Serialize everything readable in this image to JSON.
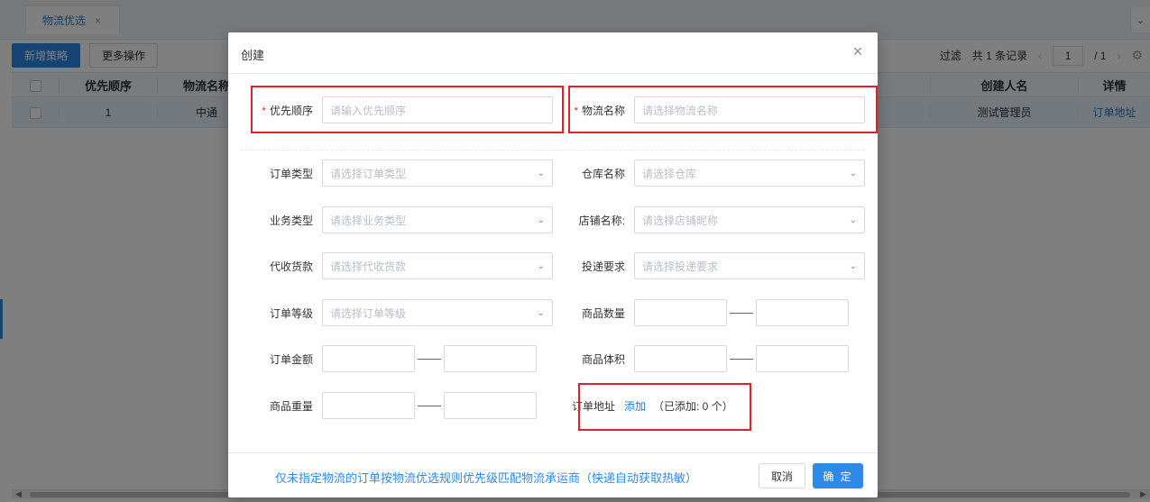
{
  "background": {
    "tab": {
      "label": "物流优选",
      "close": "×"
    },
    "toolbar": {
      "add_label": "新增策略",
      "more_label": "更多操作"
    },
    "pager": {
      "filter_text": "过滤",
      "total_text": "共 1 条记录",
      "prev": "‹",
      "page_input": "1",
      "page_text": "/ 1",
      "next": "›",
      "settings_icon": "gear-icon"
    },
    "table": {
      "headers": [
        "优先顺序",
        "物流名称",
        "创建人名",
        "详情"
      ],
      "rows": [
        {
          "priority": "1",
          "name": "中通",
          "creator": "测试管理员",
          "detail": "订单地址"
        }
      ]
    }
  },
  "dialog": {
    "title": "创建",
    "close": "×",
    "fields": {
      "priority": {
        "label": "优先顺序",
        "placeholder": "请输入优先顺序",
        "required": true
      },
      "logistics_name": {
        "label": "物流名称",
        "placeholder": "请选择物流名称",
        "required": true
      },
      "order_type": {
        "label": "订单类型",
        "placeholder": "请选择订单类型"
      },
      "warehouse": {
        "label": "仓库名称",
        "placeholder": "请选择仓库"
      },
      "business_type": {
        "label": "业务类型",
        "placeholder": "请选择业务类型"
      },
      "shop_name": {
        "label": "店铺名称:",
        "placeholder": "请选择店铺昵称"
      },
      "cod": {
        "label": "代收货款",
        "placeholder": "请选择代收货款"
      },
      "delivery_req": {
        "label": "投递要求",
        "placeholder": "请选择投递要求"
      },
      "order_level": {
        "label": "订单等级",
        "placeholder": "请选择订单等级"
      },
      "goods_qty": {
        "label": "商品数量"
      },
      "order_amount": {
        "label": "订单金额"
      },
      "goods_volume": {
        "label": "商品体积"
      },
      "goods_weight": {
        "label": "商品重量"
      },
      "order_address": {
        "label": "订单地址",
        "add_link": "添加",
        "count_text": "（已添加:  0 个）"
      }
    },
    "footer": {
      "note": "仅未指定物流的订单按物流优选规则优先级匹配物流承运商（快递自动获取热敏）",
      "cancel_label": "取消",
      "ok_label": "确 定"
    }
  },
  "colors": {
    "accent": "#2e8ae6",
    "highlight_box": "#e0212a",
    "required": "#e3332c"
  }
}
